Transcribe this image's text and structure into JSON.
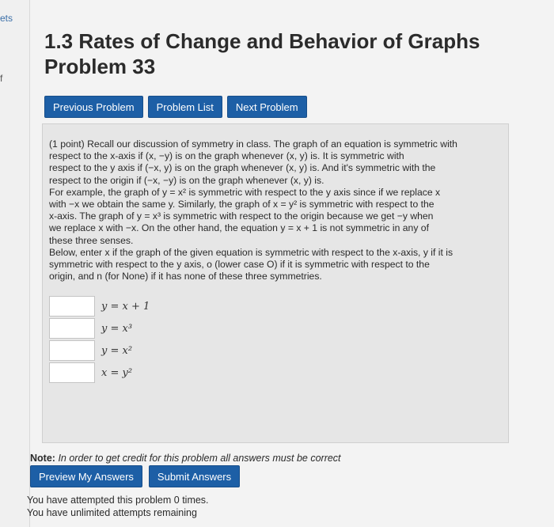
{
  "sidebar": {
    "sets_text": "ets",
    "fragment": "f"
  },
  "header": {
    "title": "1.3 Rates of Change and Behavior of Graphs",
    "problem": "Problem 33"
  },
  "nav": {
    "previous": "Previous Problem",
    "list": "Problem List",
    "next": "Next Problem"
  },
  "problem": {
    "points": "(1 point)",
    "intro": [
      "Recall our discussion of symmetry in class. The graph of an equation is symmetric with",
      "respect to the x-axis if (x, −y) is on the graph whenever (x, y) is. It is symmetric with",
      "respect to the y axis if (−x, y) is on the graph whenever (x, y) is. And it's symmetric with the",
      "respect to the origin if (−x, −y) is on the graph whenever (x, y) is.",
      "For example, the graph of y = x² is symmetric with respect to the y axis since if we replace x",
      "with −x we obtain the same y. Similarly, the graph of x = y² is symmetric with respect to the",
      "x-axis. The graph of y = x³ is symmetric with respect to the origin because we get −y when",
      "we replace x with −x. On the other hand, the equation y = x + 1 is not symmetric in any of",
      "these three senses."
    ],
    "instructions": [
      "Below, enter x if the graph of the given equation is symmetric with respect to the x-axis, y if it is",
      "symmetric with respect to the y axis, o (lower case O) if it is symmetric with respect to the",
      "origin, and n (for None) if it has none of these three symmetries."
    ],
    "answers": [
      {
        "equation": "y = x + 1",
        "value": ""
      },
      {
        "equation": "y = x³",
        "value": ""
      },
      {
        "equation": "y = x²",
        "value": ""
      },
      {
        "equation": "x = y²",
        "value": ""
      }
    ]
  },
  "note": {
    "label": "Note:",
    "text": "In order to get credit for this problem all answers must be correct"
  },
  "actions": {
    "preview": "Preview My Answers",
    "submit": "Submit Answers"
  },
  "status": {
    "attempts": "You have attempted this problem 0 times.",
    "remaining": "You have unlimited attempts remaining"
  },
  "colors": {
    "button": "#1d5fa6",
    "panel": "#e6e6e6",
    "background": "#f3f3f3"
  }
}
